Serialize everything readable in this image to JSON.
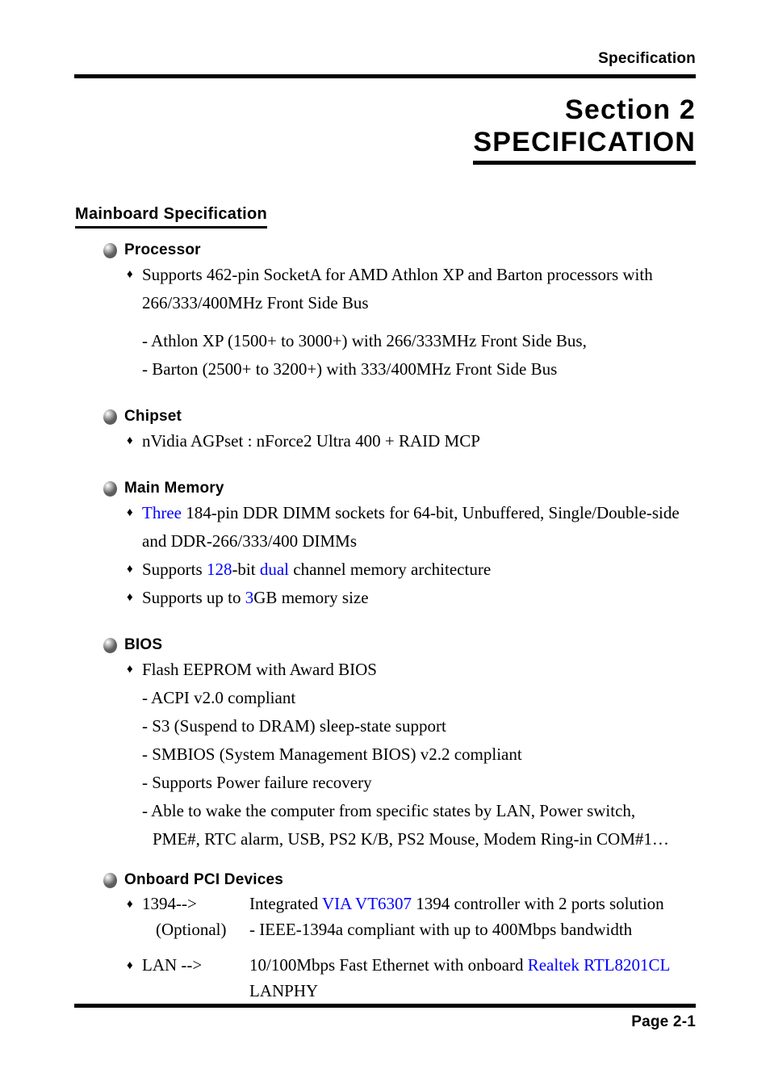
{
  "header": {
    "running_head": "Specification"
  },
  "title": {
    "line1": "Section 2",
    "line2": "SPECIFICATION"
  },
  "section_heading": "Mainboard Specification",
  "groups": [
    {
      "label": "Processor",
      "bullets": [
        "Supports 462-pin SocketA for AMD Athlon XP and Barton processors with 266/333/400MHz Front Side Bus"
      ],
      "dashes": [
        "- Athlon XP (1500+ to 3000+) with 266/333MHz Front Side Bus,",
        "- Barton (2500+ to 3200+) with 333/400MHz Front Side Bus"
      ]
    },
    {
      "label": "Chipset",
      "bullets": [
        "nVidia AGPset :  nForce2 Ultra 400 + RAID MCP"
      ]
    },
    {
      "label": "Main Memory",
      "mem_b1_a": "Three",
      "mem_b1_b": " 184-pin DDR DIMM sockets for 64-bit, Unbuffered, Single/Double-side and DDR-266/333/400 DIMMs",
      "mem_b2_a": "Supports ",
      "mem_b2_b": "128",
      "mem_b2_c": "-bit ",
      "mem_b2_d": "dual",
      "mem_b2_e": " channel memory architecture",
      "mem_b3_a": "Supports up to ",
      "mem_b3_b": "3",
      "mem_b3_c": "GB memory size"
    },
    {
      "label": "BIOS",
      "bullets": [
        "Flash EEPROM with Award BIOS"
      ],
      "dashes": [
        "- ACPI v2.0 compliant",
        "- S3 (Suspend to DRAM) sleep-state support",
        "- SMBIOS (System Management BIOS) v2.2 compliant",
        "- Supports Power failure recovery"
      ],
      "dash_wrap_a": "- Able to wake the computer from specific states by LAN, Power switch,",
      "dash_wrap_b": "PME#, RTC alarm, USB,  PS2 K/B, PS2 Mouse, Modem Ring-in  COM#1…"
    },
    {
      "label": "Onboard PCI Devices",
      "dev1_key1": "1394-->",
      "dev1_key2": "(Optional)",
      "dev1_val1_a": "Integrated ",
      "dev1_val1_b": "VIA VT6307",
      "dev1_val1_c": " 1394 controller with 2 ports solution",
      "dev1_val2": "- IEEE-1394a compliant with up to 400Mbps bandwidth",
      "dev2_key1": "LAN -->",
      "dev2_val1_a": "10/100Mbps Fast Ethernet with onboard ",
      "dev2_val1_b": "Realtek RTL8201CL",
      "dev2_val2": "LANPHY"
    }
  ],
  "footer": {
    "page_label": "Page 2-1"
  },
  "icons": {
    "sphere": "gray-sphere-bullet",
    "diamond": "♦"
  },
  "colors": {
    "accent_blue": "#0000ff",
    "rule_black": "#000000",
    "page_background": "#ffffff"
  }
}
